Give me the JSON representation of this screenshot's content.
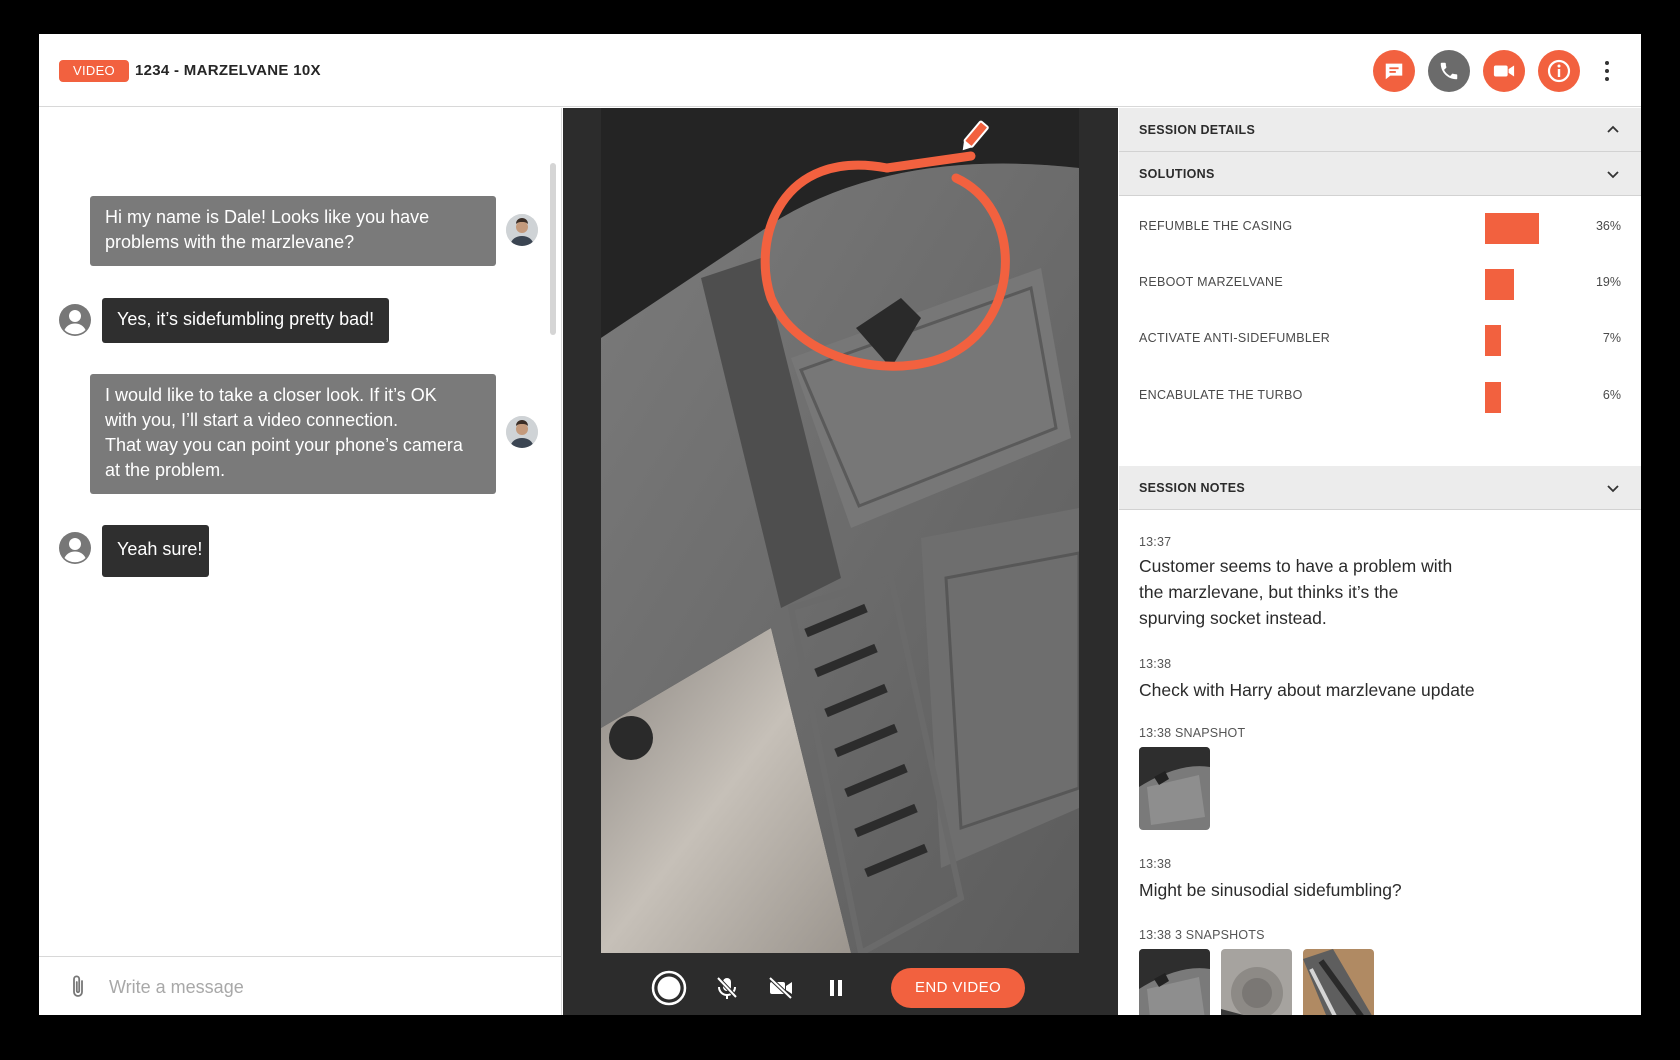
{
  "header": {
    "badge": "VIDEO",
    "title": "1234 - MARZELVANE 10X",
    "actions": [
      {
        "name": "chat-icon",
        "color": "#f2613f"
      },
      {
        "name": "phone-icon",
        "color": "#6b6b6b"
      },
      {
        "name": "video-camera-icon",
        "color": "#f2613f"
      },
      {
        "name": "info-icon",
        "color": "#f2613f"
      }
    ],
    "more_icon": "kebab-menu-icon"
  },
  "chat": {
    "messages": [
      {
        "from": "agent",
        "lines": [
          "Hi my name is Dale! Looks like you have",
          "problems with the marzlevane?"
        ]
      },
      {
        "from": "user",
        "lines": [
          "Yes, it’s sidefumbling pretty bad!"
        ]
      },
      {
        "from": "agent",
        "lines": [
          "I would like to take a closer look. If it’s OK",
          "with you, I’ll start a video connection.",
          "That way you can point your phone’s camera",
          "at the problem."
        ]
      },
      {
        "from": "user",
        "lines": [
          "Yeah sure!"
        ]
      }
    ],
    "composer": {
      "placeholder": "Write a message",
      "attach_icon": "paperclip-icon"
    }
  },
  "video": {
    "controls": {
      "snapshot_icon": "record-circle-icon",
      "mute_icon": "mic-off-icon",
      "camera_icon": "camera-off-icon",
      "pause_icon": "pause-icon",
      "end_label": "END VIDEO"
    },
    "annotation_tool_icon": "pencil-icon"
  },
  "panel": {
    "session_details": {
      "label": "SESSION DETAILS",
      "icon": "chevron-up-icon"
    },
    "solutions": {
      "label": "SOLUTIONS",
      "icon": "chevron-down-icon",
      "items": [
        {
          "name": "REFUMBLE THE CASING",
          "percent": "36%",
          "value": 36
        },
        {
          "name": "REBOOT MARZELVANE",
          "percent": "19%",
          "value": 19
        },
        {
          "name": "ACTIVATE ANTI-SIDEFUMBLER",
          "percent": "7%",
          "value": 7
        },
        {
          "name": "ENCABULATE THE TURBO",
          "percent": "6%",
          "value": 6
        }
      ]
    },
    "session_notes": {
      "label": "SESSION NOTES",
      "icon": "chevron-down-icon",
      "notes": [
        {
          "time": "13:37",
          "lines": [
            "Customer seems to have a problem with",
            "the marzlevane, but thinks it’s the",
            "spurving socket instead."
          ]
        },
        {
          "time": "13:38",
          "lines": [
            "Check with Harry about marzlevane update"
          ]
        },
        {
          "time": "13:38 SNAPSHOT",
          "snapshots": 1
        },
        {
          "time": "13:38",
          "lines": [
            "Might be sinusodial sidefumbling?"
          ]
        },
        {
          "time": "13:38 3 SNAPSHOTS",
          "snapshots": 3
        }
      ]
    }
  },
  "colors": {
    "accent": "#f2613f",
    "dark": "#2f2f2f",
    "agent_bubble": "#7a7a7a"
  }
}
